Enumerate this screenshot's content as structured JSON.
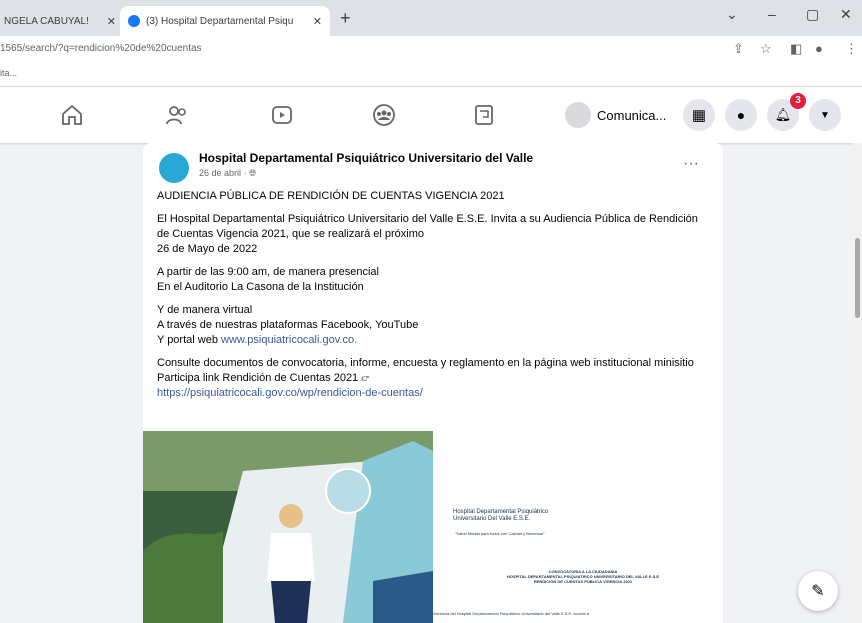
{
  "browser": {
    "tabs": [
      {
        "label": "NGELA CABUYAL! "
      },
      {
        "label": "(3) Hospital Departamental Psiqu"
      }
    ],
    "url": "1565/search/?q=rendicion%20de%20cuentas",
    "bookmark": "ita..."
  },
  "fb_nav": {
    "profile_label": "Comunica...",
    "notification_count": "3"
  },
  "post": {
    "author": "Hospital Departamental Psiquiátrico Universitario del Valle",
    "date": "26 de abril · ",
    "more": "···",
    "title_line": "AUDIENCIA PÚBLICA DE RENDICIÓN DE CUENTAS VIGENCIA 2021",
    "para1": "El Hospital Departamental Psiquiátrico Universitario del Valle E.S.E. Invita a su Audiencia Pública de Rendición de Cuentas Vigencia 2021, que se realizará el próximo",
    "para1_date": "26 de Mayo de 2022",
    "para2_l1": "A partir de las 9:00 am, de manera presencial",
    "para2_l2": "En el Auditorio La Casona de la Institución",
    "para3_l1": "Y de manera virtual",
    "para3_l2": "A través de nuestras plataformas Facebook, YouTube",
    "para3_l3": "Y portal web ",
    "para3_link": "www.psiquiatricocali.gov.co.",
    "para4": "Consulte documentos de convocatoria, informe, encuesta y reglamento en la página web institucional minisitio Participa link Rendición de Cuentas 2021 ",
    "para4_link": "https://psiquiatricocali.gov.co/wp/rendicion-de-cuentas/",
    "image": {
      "org_name_l1": "Hospital Departamental Psiquiátrico",
      "org_name_l2": "Universitario Del Valle E.S.E.",
      "slogan": "\"Salud Mental para todos con Calidad y Bienestar\"",
      "conv_l1": "CONVOCATORIA A LA CIUDADANIA",
      "conv_l2": "HOSPITAL DEPARTAMENTAL PSIQUIATRICO UNIVERSITARIO DEL VALLE E.S.E",
      "conv_l3": "RENDICIÓN DE CUENTAS PÚBLICA VIGENCIA 2021",
      "footer": "Gerencia del Hospital Departamental Psiquiátrico Universitario del Valle E.S.E. acorde a"
    }
  }
}
